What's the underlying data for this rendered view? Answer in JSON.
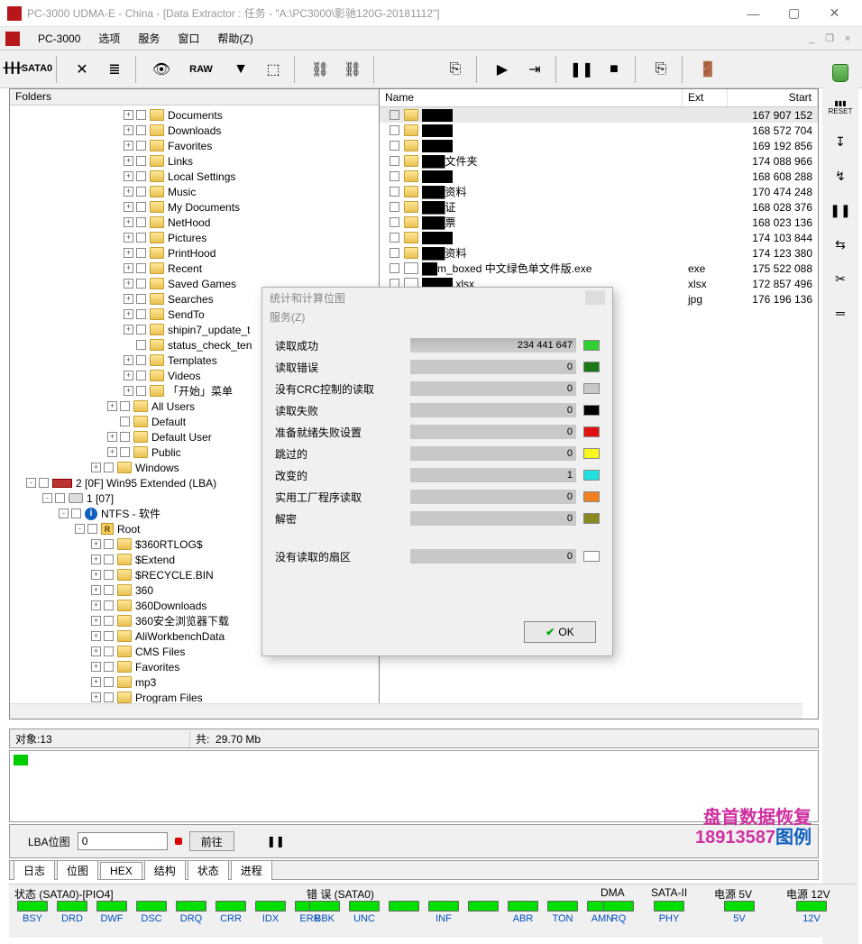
{
  "window": {
    "title": "PC-3000 UDMA-E - China - [Data Extractor : 任务 - \"A:\\PC3000\\影驰120G-20181112\"]"
  },
  "menu": {
    "app": "PC-3000",
    "items": [
      "选项",
      "服务",
      "窗口",
      "帮助(Z)"
    ]
  },
  "toolbar": {
    "sata0": "SATA0",
    "raw": "RAW"
  },
  "left_pane_title": "Folders",
  "tree": [
    {
      "d": 7,
      "t": "+",
      "label": "Documents"
    },
    {
      "d": 7,
      "t": "+",
      "label": "Downloads"
    },
    {
      "d": 7,
      "t": "+",
      "label": "Favorites"
    },
    {
      "d": 7,
      "t": "+",
      "label": "Links"
    },
    {
      "d": 7,
      "t": "+",
      "label": "Local Settings"
    },
    {
      "d": 7,
      "t": "+",
      "label": "Music"
    },
    {
      "d": 7,
      "t": "+",
      "label": "My Documents"
    },
    {
      "d": 7,
      "t": "+",
      "label": "NetHood"
    },
    {
      "d": 7,
      "t": "+",
      "label": "Pictures"
    },
    {
      "d": 7,
      "t": "+",
      "label": "PrintHood"
    },
    {
      "d": 7,
      "t": "+",
      "label": "Recent"
    },
    {
      "d": 7,
      "t": "+",
      "label": "Saved Games"
    },
    {
      "d": 7,
      "t": "+",
      "label": "Searches"
    },
    {
      "d": 7,
      "t": "+",
      "label": "SendTo"
    },
    {
      "d": 7,
      "t": "+",
      "label": "shipin7_update_t"
    },
    {
      "d": 7,
      "t": "",
      "label": "status_check_ten"
    },
    {
      "d": 7,
      "t": "+",
      "label": "Templates"
    },
    {
      "d": 7,
      "t": "+",
      "label": "Videos"
    },
    {
      "d": 7,
      "t": "+",
      "label": "「开始」菜单"
    },
    {
      "d": 6,
      "t": "+",
      "label": "All Users"
    },
    {
      "d": 6,
      "t": "",
      "label": "Default"
    },
    {
      "d": 6,
      "t": "+",
      "label": "Default User"
    },
    {
      "d": 6,
      "t": "+",
      "label": "Public"
    },
    {
      "d": 5,
      "t": "+",
      "label": "Windows"
    },
    {
      "d": 1,
      "t": "-",
      "label": "2 [0F] Win95 Extended  (LBA)",
      "icon": "part"
    },
    {
      "d": 2,
      "t": "-",
      "label": "1 [07]",
      "icon": "drive"
    },
    {
      "d": 3,
      "t": "-",
      "label": "NTFS - 软件",
      "icon": "info"
    },
    {
      "d": 4,
      "t": "-",
      "label": "Root",
      "icon": "r"
    },
    {
      "d": 5,
      "t": "+",
      "label": "$360RTLOG$"
    },
    {
      "d": 5,
      "t": "+",
      "label": "$Extend"
    },
    {
      "d": 5,
      "t": "+",
      "label": "$RECYCLE.BIN"
    },
    {
      "d": 5,
      "t": "+",
      "label": "360"
    },
    {
      "d": 5,
      "t": "+",
      "label": "360Downloads"
    },
    {
      "d": 5,
      "t": "+",
      "label": "360安全浏览器下载"
    },
    {
      "d": 5,
      "t": "+",
      "label": "AliWorkbenchData"
    },
    {
      "d": 5,
      "t": "+",
      "label": "CMS Files"
    },
    {
      "d": 5,
      "t": "+",
      "label": "Favorites"
    },
    {
      "d": 5,
      "t": "+",
      "label": "mp3"
    },
    {
      "d": 5,
      "t": "+",
      "label": "Program Files"
    }
  ],
  "file_cols": {
    "name": "Name",
    "ext": "Ext",
    "start": "Start"
  },
  "files": [
    {
      "name": "████",
      "ext": "",
      "start": "167 907 152",
      "sel": true,
      "folder": true
    },
    {
      "name": "████",
      "ext": "",
      "start": "168 572 704",
      "folder": true
    },
    {
      "name": "████",
      "ext": "",
      "start": "169 192 856",
      "folder": true
    },
    {
      "name": "███文件夹",
      "ext": "",
      "start": "174 088 966",
      "folder": true
    },
    {
      "name": "████",
      "ext": "",
      "start": "168 608 288",
      "folder": true
    },
    {
      "name": "███资料",
      "ext": "",
      "start": "170 474 248",
      "folder": true
    },
    {
      "name": "███证",
      "ext": "",
      "start": "168 028 376",
      "folder": true
    },
    {
      "name": "███票",
      "ext": "",
      "start": "168 023 136",
      "folder": true
    },
    {
      "name": "████",
      "ext": "",
      "start": "174 103 844",
      "folder": true
    },
    {
      "name": "███资料",
      "ext": "",
      "start": "174 123 380",
      "folder": true
    },
    {
      "name": "██m_boxed 中文绿色单文件版.exe",
      "ext": "exe",
      "start": "175 522 088",
      "folder": false
    },
    {
      "name": "████.xlsx",
      "ext": "xlsx",
      "start": "172 857 496",
      "folder": false
    },
    {
      "name": "",
      "ext": "jpg",
      "start": "176 196 136",
      "folder": false
    }
  ],
  "info": {
    "objects_label": "对象:",
    "objects": "13",
    "total_label": "共:",
    "total": "29.70 Mb"
  },
  "lba": {
    "label": "LBA位图",
    "value": "0",
    "go": "前往"
  },
  "tabs": [
    "日志",
    "位图",
    "HEX",
    "结构",
    "状态",
    "进程"
  ],
  "status": {
    "g1_label": "状态 (SATA0)-[PIO4]",
    "g1": [
      "BSY",
      "DRD",
      "DWF",
      "DSC",
      "DRQ",
      "CRR",
      "IDX",
      "ERR"
    ],
    "g2_label": "错 误 (SATA0)",
    "g2": [
      "BBK",
      "UNC",
      "",
      "INF",
      "",
      "ABR",
      "TON",
      "AMN"
    ],
    "dma_label": "DMA",
    "dma": [
      "RQ"
    ],
    "sata2_label": "SATA-II",
    "sata2": [
      "PHY"
    ],
    "p5_label": "电源 5V",
    "p5": [
      "5V"
    ],
    "p12_label": "电源 12V",
    "p12": [
      "12V"
    ]
  },
  "dialog": {
    "title": "统计和计算位图",
    "menu": "服务(Z)",
    "rows": [
      {
        "label": "读取成功",
        "value": "234 441 647",
        "color": "#30d030",
        "full": true
      },
      {
        "label": "读取错误",
        "value": "0",
        "color": "#1a7a1a"
      },
      {
        "label": "没有CRC控制的读取",
        "value": "0",
        "color": "#c8c8c8"
      },
      {
        "label": "读取失败",
        "value": "0",
        "color": "#000000"
      },
      {
        "label": "准备就绪失败设置",
        "value": "0",
        "color": "#e01010"
      },
      {
        "label": "跳过的",
        "value": "0",
        "color": "#f8f820"
      },
      {
        "label": "改变的",
        "value": "1",
        "color": "#20e0e0"
      },
      {
        "label": "实用工厂程序读取",
        "value": "0",
        "color": "#f08020"
      },
      {
        "label": "解密",
        "value": "0",
        "color": "#888820"
      }
    ],
    "row_unread": {
      "label": "没有读取的扇区",
      "value": "0",
      "color": "#ffffff"
    },
    "ok": "OK"
  },
  "watermark": {
    "line1": "盘首数据恢复",
    "line2": "18913587",
    "line3": "图例"
  },
  "sidebar_labels": [
    "RESET"
  ]
}
